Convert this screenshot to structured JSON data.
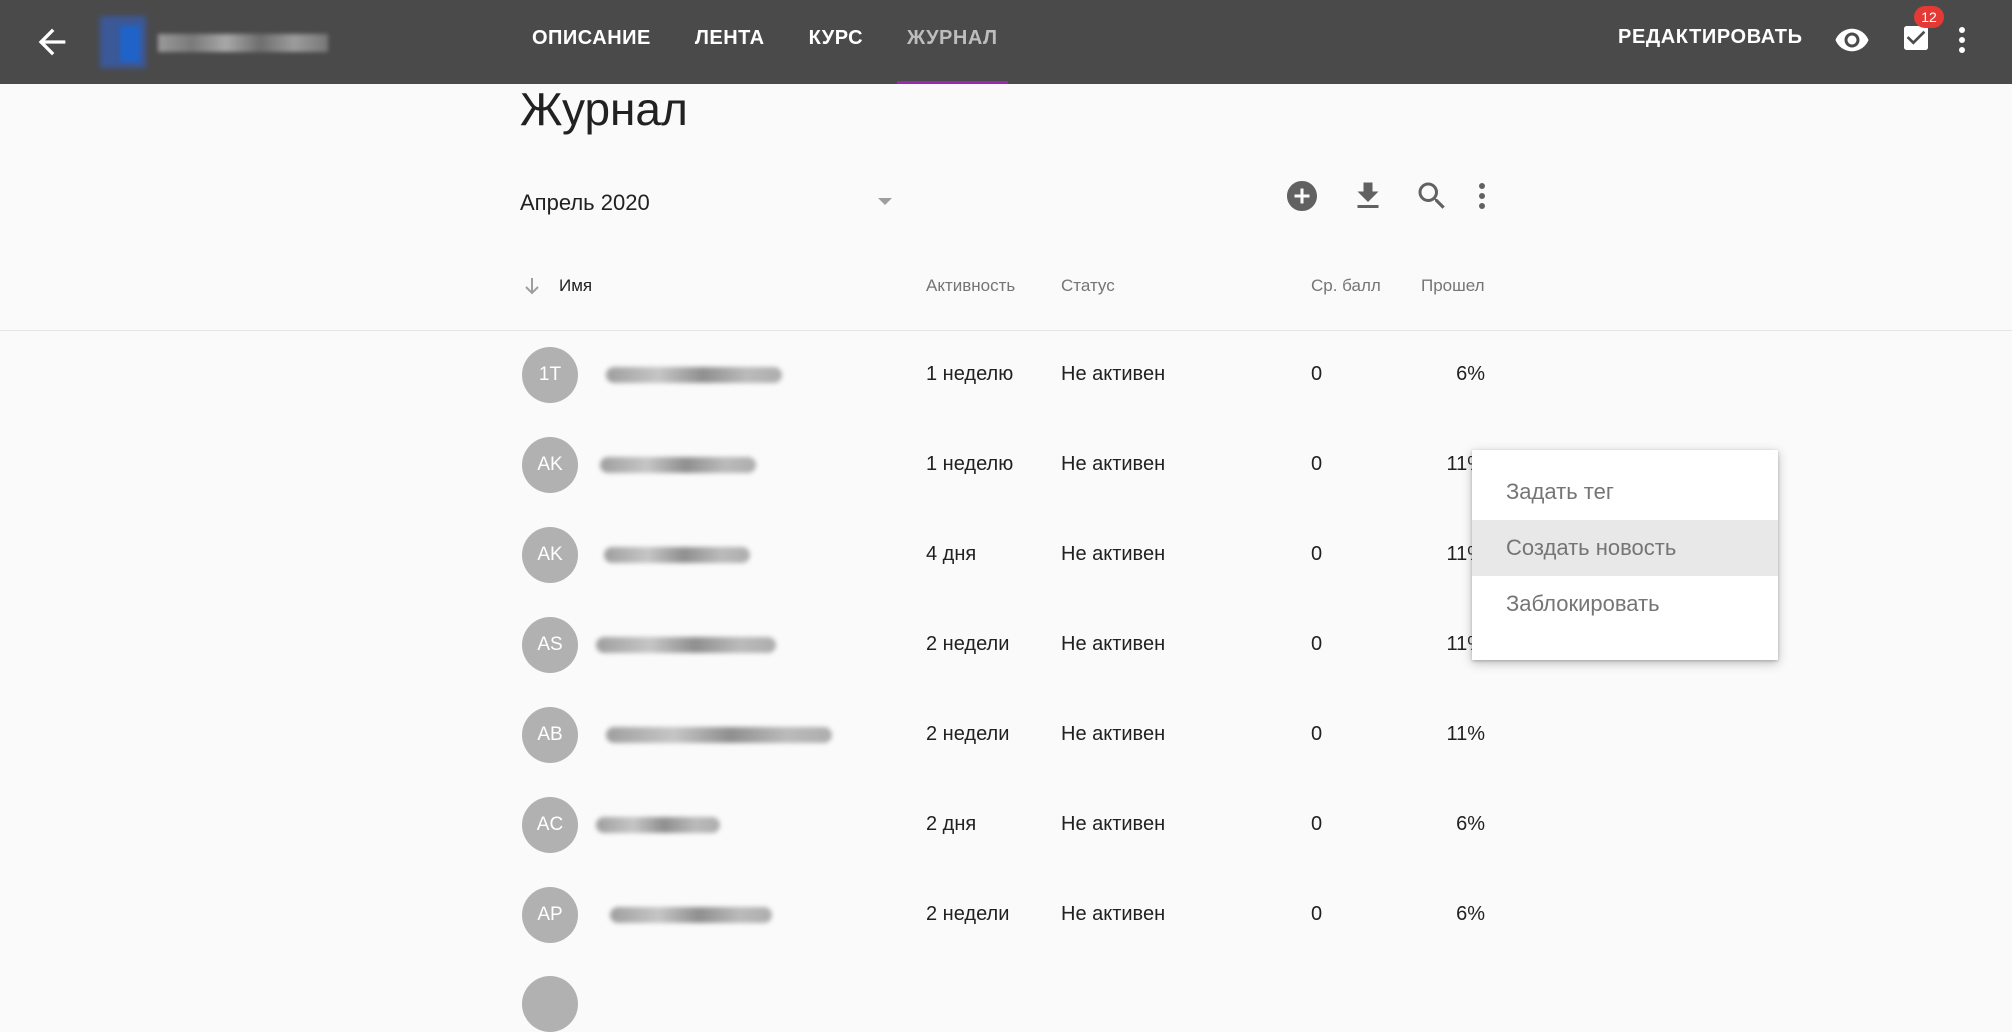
{
  "topbar": {
    "tabs": [
      {
        "label": "ОПИСАНИЕ",
        "active": false
      },
      {
        "label": "ЛЕНТА",
        "active": false
      },
      {
        "label": "КУРС",
        "active": false
      },
      {
        "label": "ЖУРНАЛ",
        "active": true
      }
    ],
    "edit_label": "РЕДАКТИРОВАТЬ",
    "tasks_badge": "12",
    "icons": [
      "arrow-back-icon",
      "eye-icon",
      "checkbox-tasks-icon",
      "more-vert-icon"
    ]
  },
  "page": {
    "title": "Журнал",
    "month": "Апрель 2020",
    "toolbar_icons": [
      "add-circle-icon",
      "download-icon",
      "search-icon",
      "more-vert-icon"
    ]
  },
  "table": {
    "columns": {
      "name": "Имя",
      "activity": "Активность",
      "status": "Статус",
      "avg": "Ср. балл",
      "passed": "Прошел"
    },
    "rows": [
      {
        "initials": "1T",
        "activity": "1 неделю",
        "status": "Не активен",
        "avg": "0",
        "passed": "6%"
      },
      {
        "initials": "AK",
        "activity": "1 неделю",
        "status": "Не активен",
        "avg": "0",
        "passed": "11%"
      },
      {
        "initials": "AK",
        "activity": "4 дня",
        "status": "Не активен",
        "avg": "0",
        "passed": "11%"
      },
      {
        "initials": "AS",
        "activity": "2 недели",
        "status": "Не активен",
        "avg": "0",
        "passed": "11%"
      },
      {
        "initials": "AB",
        "activity": "2 недели",
        "status": "Не активен",
        "avg": "0",
        "passed": "11%"
      },
      {
        "initials": "AC",
        "activity": "2 дня",
        "status": "Не активен",
        "avg": "0",
        "passed": "6%"
      },
      {
        "initials": "AP",
        "activity": "2 недели",
        "status": "Не активен",
        "avg": "0",
        "passed": "6%"
      }
    ]
  },
  "context_menu": {
    "items": [
      {
        "label": "Задать тег",
        "highlighted": false
      },
      {
        "label": "Создать новость",
        "highlighted": true
      },
      {
        "label": "Заблокировать",
        "highlighted": false
      }
    ]
  },
  "colors": {
    "topbar": "#4a4a4a",
    "active_tab_indicator": "#9c27b0",
    "badge": "#e53935",
    "avatar": "#b1b1b1"
  }
}
